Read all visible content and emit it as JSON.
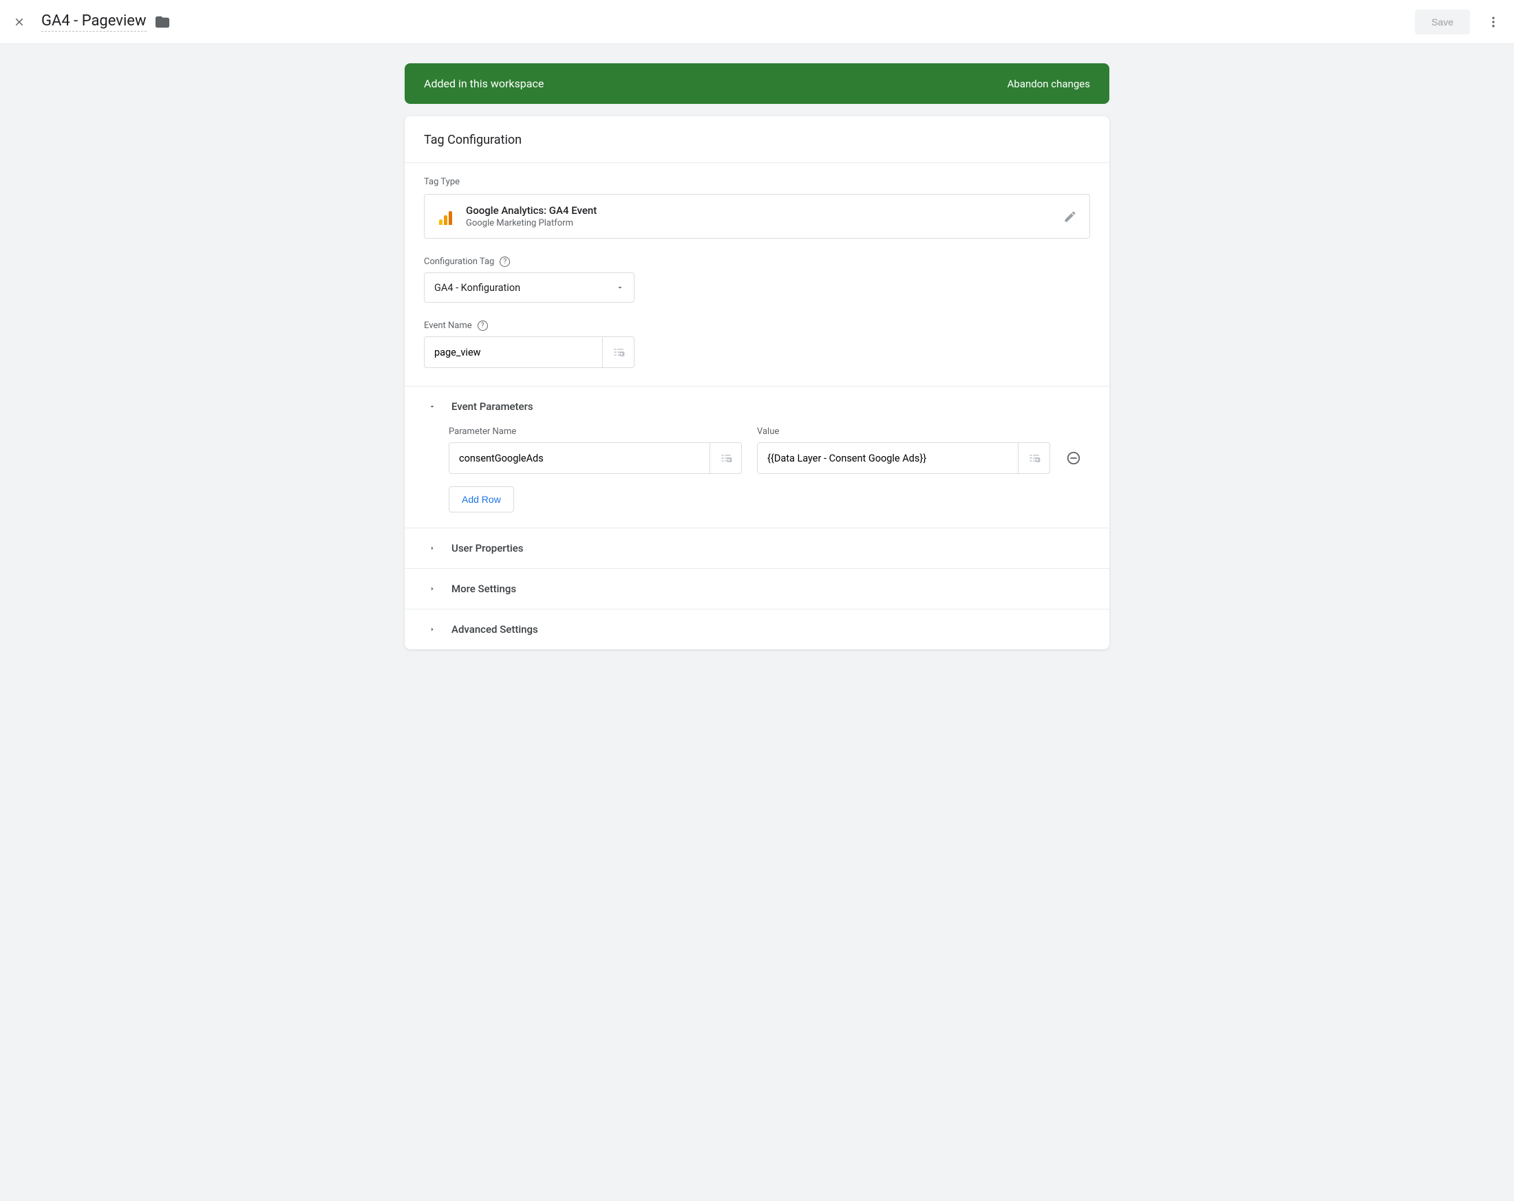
{
  "header": {
    "title": "GA4 - Pageview",
    "save_label": "Save"
  },
  "banner": {
    "message": "Added in this workspace",
    "action": "Abandon changes"
  },
  "card": {
    "title": "Tag Configuration",
    "tag_type_label": "Tag Type",
    "tag_type_name": "Google Analytics: GA4 Event",
    "tag_type_sub": "Google Marketing Platform",
    "config_tag_label": "Configuration Tag",
    "config_tag_value": "GA4 - Konfiguration",
    "event_name_label": "Event Name",
    "event_name_value": "page_view",
    "event_params_label": "Event Parameters",
    "param_name_header": "Parameter Name",
    "param_value_header": "Value",
    "param_rows": [
      {
        "name": "consentGoogleAds",
        "value": "{{Data Layer - Consent Google Ads}}"
      }
    ],
    "add_row_label": "Add Row",
    "user_props_label": "User Properties",
    "more_settings_label": "More Settings",
    "advanced_label": "Advanced Settings"
  }
}
